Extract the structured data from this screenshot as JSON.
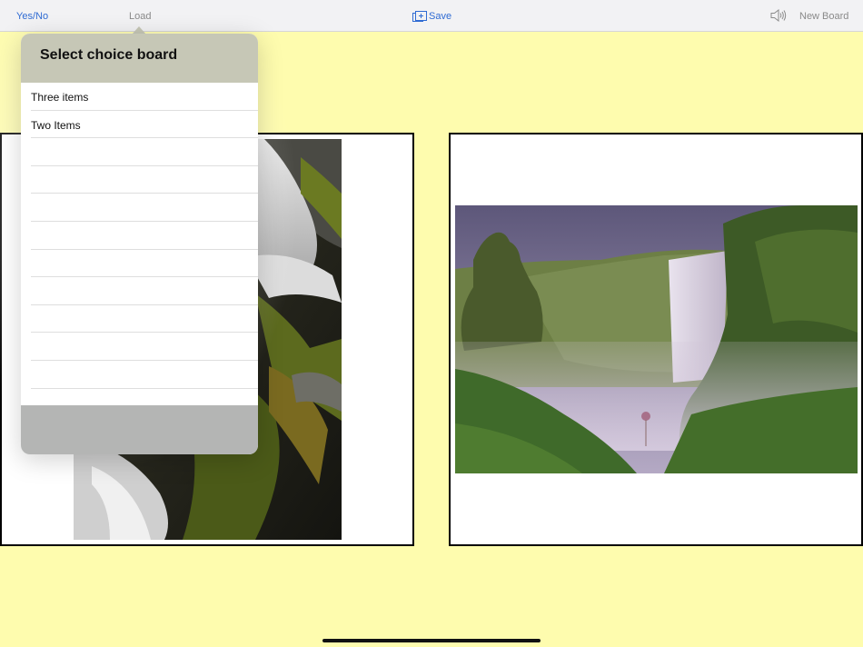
{
  "toolbar": {
    "yes_no_label": "Yes/No",
    "load_label": "Load",
    "save_label": "Save",
    "new_board_label": "New Board",
    "accent_color": "#2f6bd3"
  },
  "popover": {
    "title": "Select choice board",
    "items": [
      {
        "label": "Three items"
      },
      {
        "label": "Two Items"
      },
      {
        "label": ""
      },
      {
        "label": ""
      },
      {
        "label": ""
      },
      {
        "label": ""
      },
      {
        "label": ""
      },
      {
        "label": ""
      },
      {
        "label": ""
      },
      {
        "label": ""
      },
      {
        "label": ""
      }
    ]
  },
  "board": {
    "background_color": "#fefcae",
    "cards": [
      {
        "image": "waterfall-closeup-photo"
      },
      {
        "image": "waterfall-landscape-photo"
      }
    ]
  },
  "icons": {
    "save": "add-to-gallery-icon",
    "speaker": "speaker-icon"
  }
}
